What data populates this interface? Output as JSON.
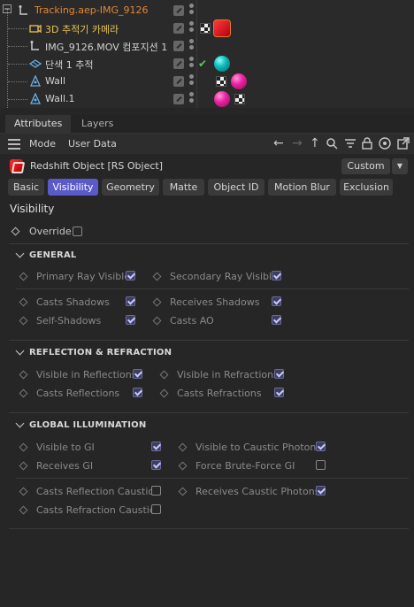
{
  "tree": {
    "rows": [
      {
        "label": "Tracking.aep-IMG_9126"
      },
      {
        "label": "3D 추적기 카메라"
      },
      {
        "label": "IMG_9126.MOV 컴포지션 1"
      },
      {
        "label": "단색 1 추적"
      },
      {
        "label": "Wall"
      },
      {
        "label": "Wall.1"
      }
    ]
  },
  "panel_tabs": {
    "attributes": "Attributes",
    "layers": "Layers"
  },
  "toolbar": {
    "mode": "Mode",
    "user_data": "User Data"
  },
  "object": {
    "title": "Redshift Object [RS Object]",
    "preset": "Custom"
  },
  "subtabs": [
    "Basic",
    "Visibility",
    "Geometry",
    "Matte",
    "Object ID",
    "Motion Blur",
    "Exclusion"
  ],
  "section_title": "Visibility",
  "override": {
    "label": "Override",
    "checked": false
  },
  "groups": {
    "general": {
      "title": "GENERAL",
      "items": [
        {
          "label": "Primary Ray Visible",
          "checked": true
        },
        {
          "label": "Secondary Ray Visible",
          "checked": true
        },
        {
          "label": "Casts Shadows",
          "checked": true
        },
        {
          "label": "Receives Shadows",
          "checked": true
        },
        {
          "label": "Self-Shadows",
          "checked": true
        },
        {
          "label": "Casts AO",
          "checked": true
        }
      ]
    },
    "reflection": {
      "title": "REFLECTION & REFRACTION",
      "items": [
        {
          "label": "Visible in Reflections",
          "checked": true
        },
        {
          "label": "Visible in Refractions",
          "checked": true
        },
        {
          "label": "Casts Reflections",
          "checked": true
        },
        {
          "label": "Casts Refractions",
          "checked": true
        }
      ]
    },
    "gi": {
      "title": "GLOBAL ILLUMINATION",
      "items": [
        {
          "label": "Visible to GI",
          "checked": true
        },
        {
          "label": "Visible to Caustic Photons",
          "checked": true
        },
        {
          "label": "Receives GI",
          "checked": true
        },
        {
          "label": "Force Brute-Force GI",
          "checked": false
        },
        {
          "label": "Casts Reflection Caustics",
          "checked": false
        },
        {
          "label": "Receives Caustic Photons",
          "checked": true
        },
        {
          "label": "Casts Refraction Caustics",
          "checked": false
        }
      ]
    }
  },
  "colors": {
    "active_tab": "#5a5ac8",
    "selected_name": "#e0873a",
    "background": "#262626"
  }
}
